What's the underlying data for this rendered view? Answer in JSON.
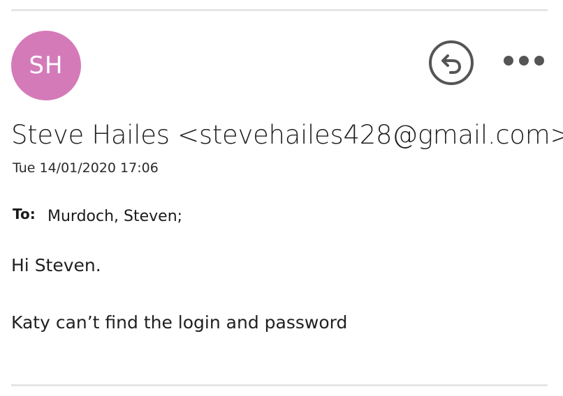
{
  "avatar": {
    "initials": "SH",
    "color": "#d57ab9"
  },
  "actions": {
    "reply_icon": "reply-icon",
    "more_icon": "more-options-icon"
  },
  "header": {
    "sender": "Steve Hailes <stevehailes428@gmail.com>",
    "date": "Tue 14/01/2020 17:06"
  },
  "recipients": {
    "label": "To:",
    "value": "Murdoch, Steven;"
  },
  "body": {
    "lines": [
      "Hi Steven.",
      "Katy can’t find the login and password"
    ]
  }
}
